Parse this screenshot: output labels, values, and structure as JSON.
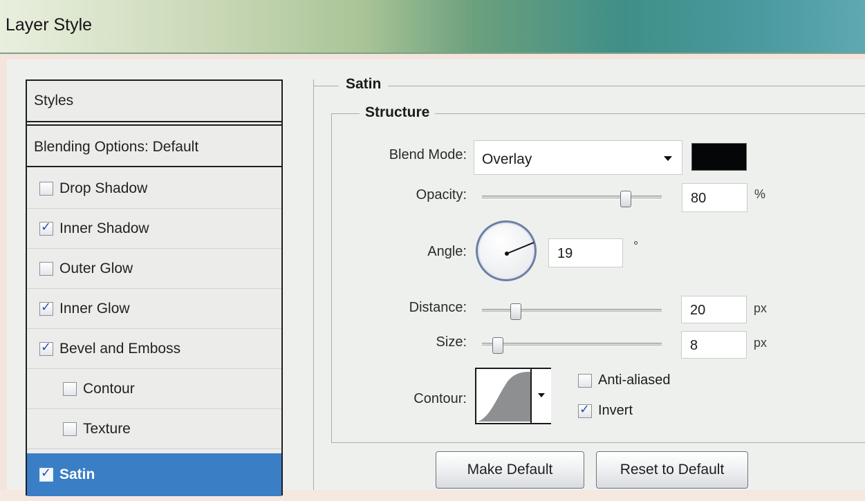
{
  "window": {
    "title": "Layer Style"
  },
  "styles_panel": {
    "header": "Styles",
    "blending": "Blending Options: Default",
    "items": [
      {
        "label": "Drop Shadow",
        "checked": false
      },
      {
        "label": "Inner Shadow",
        "checked": true
      },
      {
        "label": "Outer Glow",
        "checked": false
      },
      {
        "label": "Inner Glow",
        "checked": true
      },
      {
        "label": "Bevel and Emboss",
        "checked": true
      },
      {
        "label": "Contour",
        "checked": false
      },
      {
        "label": "Texture",
        "checked": false
      },
      {
        "label": "Satin",
        "checked": true,
        "selected": true
      }
    ]
  },
  "satin": {
    "section_title": "Satin",
    "structure_title": "Structure",
    "blend_mode": {
      "label": "Blend Mode:",
      "value": "Overlay",
      "color": "#050608"
    },
    "opacity": {
      "label": "Opacity:",
      "value": "80",
      "unit": "%",
      "slider_fraction": 0.8
    },
    "angle": {
      "label": "Angle:",
      "value": "19",
      "unit": "°"
    },
    "distance": {
      "label": "Distance:",
      "value": "20",
      "unit": "px",
      "slider_fraction": 0.2
    },
    "size": {
      "label": "Size:",
      "value": "8",
      "unit": "px",
      "slider_fraction": 0.08
    },
    "contour": {
      "label": "Contour:"
    },
    "anti_aliased": {
      "label": "Anti-aliased",
      "checked": false
    },
    "invert": {
      "label": "Invert",
      "checked": true
    }
  },
  "buttons": {
    "make_default": "Make Default",
    "reset_default": "Reset to Default"
  }
}
